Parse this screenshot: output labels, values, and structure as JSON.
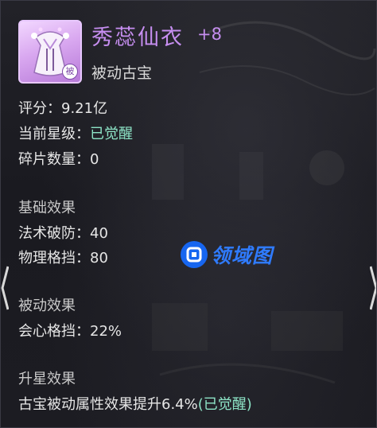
{
  "item": {
    "name": "秀蕊仙衣",
    "enhance_level": "+8",
    "type": "被动古宝",
    "icon_badge": "被",
    "icon": "robe-icon"
  },
  "stats": {
    "score_label": "评分：",
    "score_value": "9.21亿",
    "star_label": "当前星级：",
    "star_value": "已觉醒",
    "shard_label": "碎片数量：",
    "shard_value": "0"
  },
  "basic_effects": {
    "title": "基础效果",
    "items": [
      {
        "label": "法术破防：",
        "value": "40"
      },
      {
        "label": "物理格挡：",
        "value": "80"
      }
    ]
  },
  "passive_effects": {
    "title": "被动效果",
    "items": [
      {
        "label": "会心格挡：",
        "value": "22%"
      }
    ]
  },
  "star_effects": {
    "title": "升星效果",
    "text": "古宝被动属性效果提升6.4%",
    "status": "(已觉醒)"
  },
  "watermark": {
    "text": "领域图"
  },
  "colors": {
    "title": "#c68ef0",
    "awakened": "#8de3c6",
    "text": "#e6e6e6",
    "watermark": "#2f7bff"
  }
}
